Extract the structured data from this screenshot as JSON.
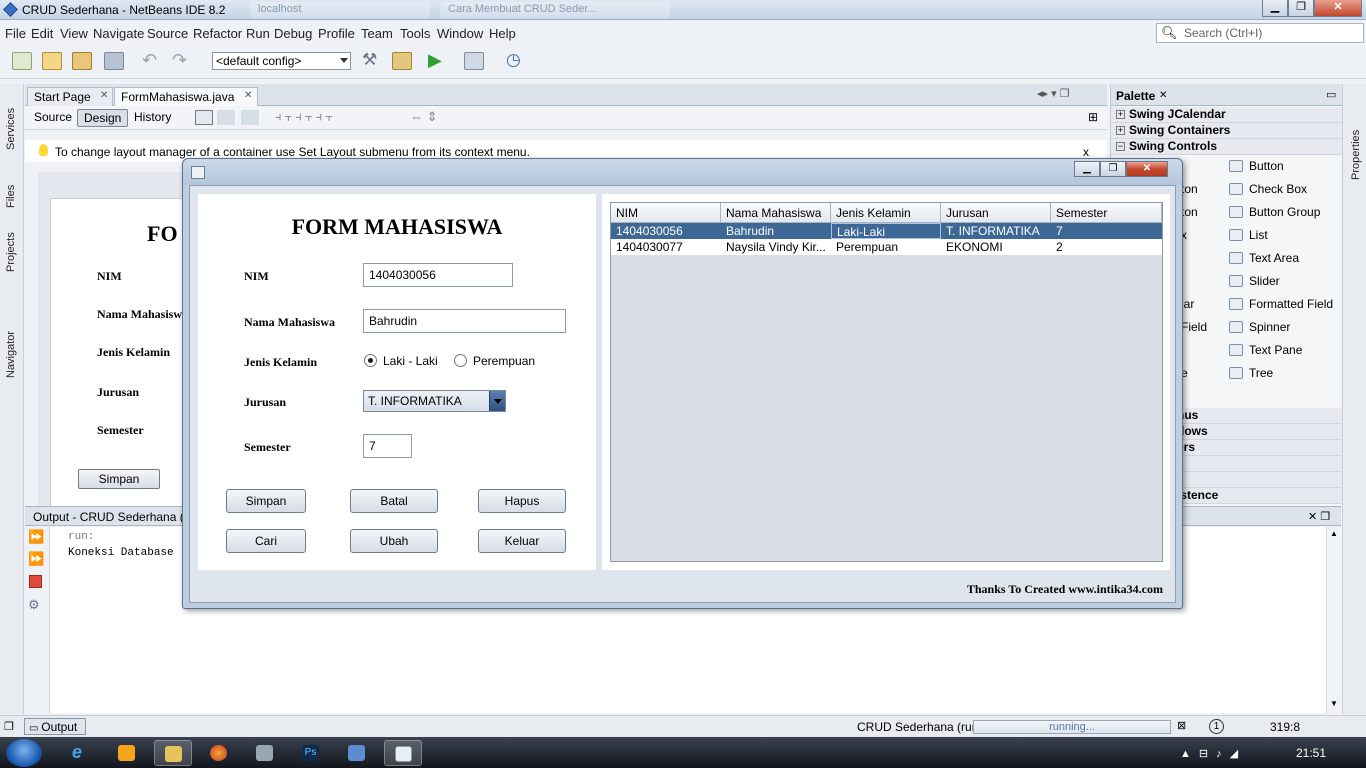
{
  "window": {
    "title": "CRUD Sederhana - NetBeans IDE 8.2",
    "bg_tabs": [
      "localhost",
      "Cara Membuat CRUD Seder..."
    ]
  },
  "menu": [
    "File",
    "Edit",
    "View",
    "Navigate",
    "Source",
    "Refactor",
    "Run",
    "Debug",
    "Profile",
    "Team",
    "Tools",
    "Window",
    "Help"
  ],
  "search": {
    "placeholder": "Search (Ctrl+I)"
  },
  "toolbar": {
    "config": "<default config>"
  },
  "leftbar": [
    "Services",
    "Files",
    "Projects",
    "Navigator"
  ],
  "rightbar": [
    "Properties"
  ],
  "editor": {
    "tabs": [
      {
        "label": "Start Page"
      },
      {
        "label": "FormMahasiswa.java"
      }
    ],
    "modes": [
      "Source",
      "Design",
      "History"
    ],
    "hint": "To change layout manager of a container use Set Layout submenu from its context menu.",
    "hint_close": "x"
  },
  "designer": {
    "title": "FO",
    "labels": [
      "NIM",
      "Nama Mahasisw",
      "Jenis Kelamin",
      "Jurusan",
      "Semester"
    ],
    "button": "Simpan"
  },
  "palette": {
    "title": "Palette",
    "categories_top": [
      "Swing JCalendar",
      "Swing Containers",
      "Swing Controls"
    ],
    "partial_left": [
      "ton",
      "ton",
      "x",
      "",
      "",
      "lar",
      "Field",
      "",
      "e"
    ],
    "items": [
      "Button",
      "Check Box",
      "Button Group",
      "List",
      "Text Area",
      "Slider",
      "Formatted Field",
      "Spinner",
      "Text Pane",
      "Tree"
    ],
    "categories_bottom": [
      "nus",
      "dows",
      "ers",
      "",
      "istence"
    ]
  },
  "output": {
    "title": "Output - CRUD Sederhana (r",
    "lines": [
      "run:",
      "Koneksi Database"
    ]
  },
  "status": {
    "output_tab": "Output",
    "run_label": "CRUD Sederhana (run)",
    "progress": "running...",
    "notifications": "1",
    "position": "319:8"
  },
  "taskbar": {
    "clock": "21:51"
  },
  "dialog": {
    "form_title": "FORM MAHASISWA",
    "labels": {
      "nim": "NIM",
      "nama": "Nama Mahasiswa",
      "jk": "Jenis Kelamin",
      "jurusan": "Jurusan",
      "semester": "Semester"
    },
    "values": {
      "nim": "1404030056",
      "nama": "Bahrudin",
      "jurusan": "T. INFORMATIKA",
      "semester": "7"
    },
    "radio": {
      "male": "Laki - Laki",
      "female": "Perempuan",
      "selected": "male"
    },
    "buttons": [
      "Simpan",
      "Batal",
      "Hapus",
      "Cari",
      "Ubah",
      "Keluar"
    ],
    "table": {
      "columns": [
        "NIM",
        "Nama Mahasiswa",
        "Jenis Kelamin",
        "Jurusan",
        "Semester"
      ],
      "rows": [
        [
          "1404030056",
          "Bahrudin",
          "Laki-Laki",
          "T. INFORMATIKA",
          "7"
        ],
        [
          "1404030077",
          "Naysila Vindy Kir...",
          "Perempuan",
          "EKONOMI",
          "2"
        ]
      ],
      "selected_row": 0
    },
    "credits": "Thanks To Created www.intika34.com"
  },
  "colors": {
    "selection": "#3d6794",
    "dialog_frame": "#bfcfe2",
    "close_button": "#c44a2f"
  }
}
